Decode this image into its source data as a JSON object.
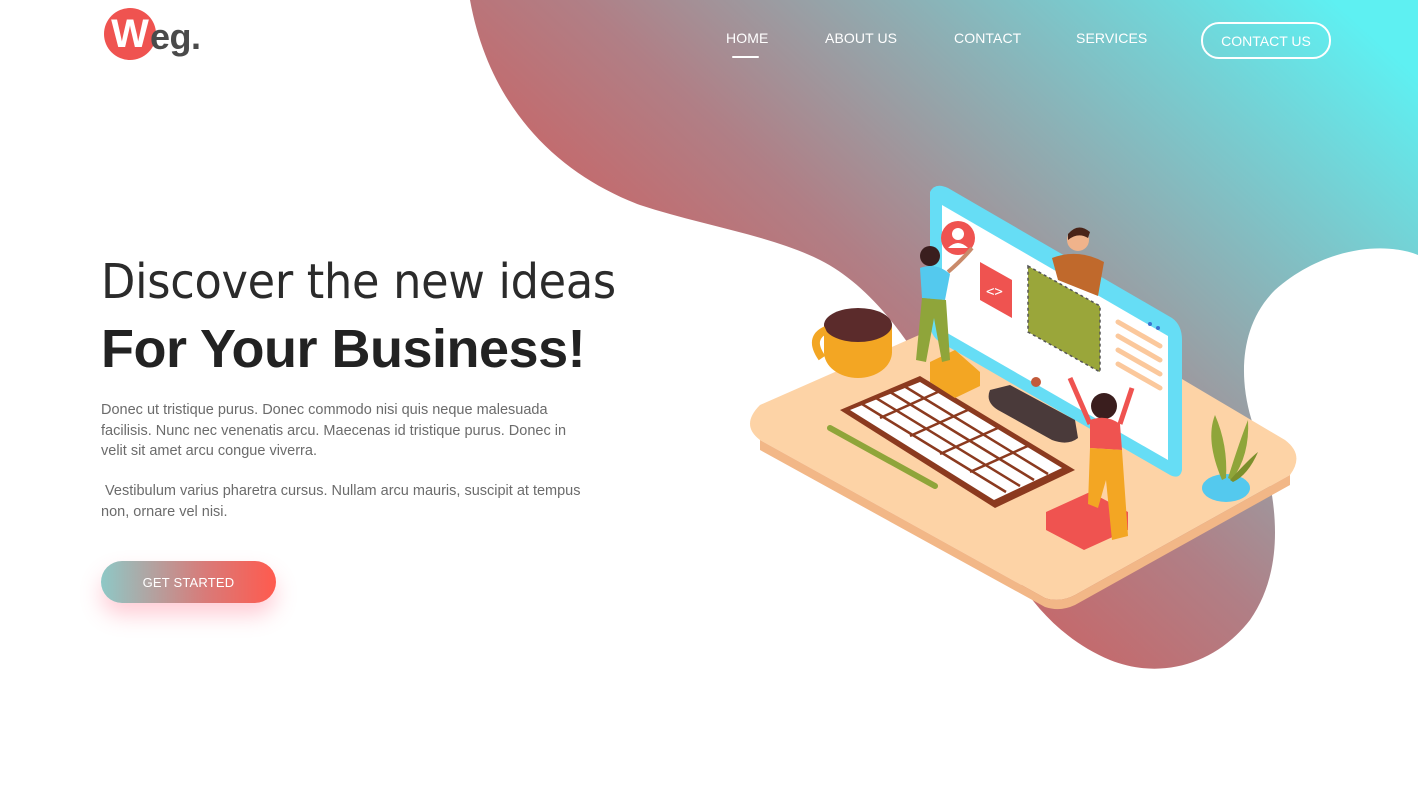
{
  "brand": {
    "logo_letter": "W",
    "logo_rest": "eg."
  },
  "nav": {
    "items": [
      {
        "label": "HOME",
        "active": true
      },
      {
        "label": "ABOUT US",
        "active": false
      },
      {
        "label": "CONTACT",
        "active": false
      },
      {
        "label": "SERVICES",
        "active": false
      }
    ],
    "cta_label": "CONTACT US"
  },
  "hero": {
    "title_line1": "Discover the new ideas",
    "title_line2": "For Your Business!",
    "paragraph1": "Donec ut tristique purus. Donec commodo nisi quis neque malesuada facilisis. Nunc nec venenatis arcu. Maecenas id tristique purus. Donec in velit sit amet arcu congue viverra.",
    "paragraph2": " Vestibulum varius pharetra cursus. Nullam arcu mauris, suscipit at tempus non, ornare vel nisi.",
    "button_label": "GET STARTED"
  },
  "colors": {
    "brand_red": "#ef5350",
    "gradient_red": "#e8443f",
    "gradient_cyan": "#5ef0f2"
  },
  "illustration": {
    "icons": [
      "code-icon",
      "user-icon"
    ]
  }
}
